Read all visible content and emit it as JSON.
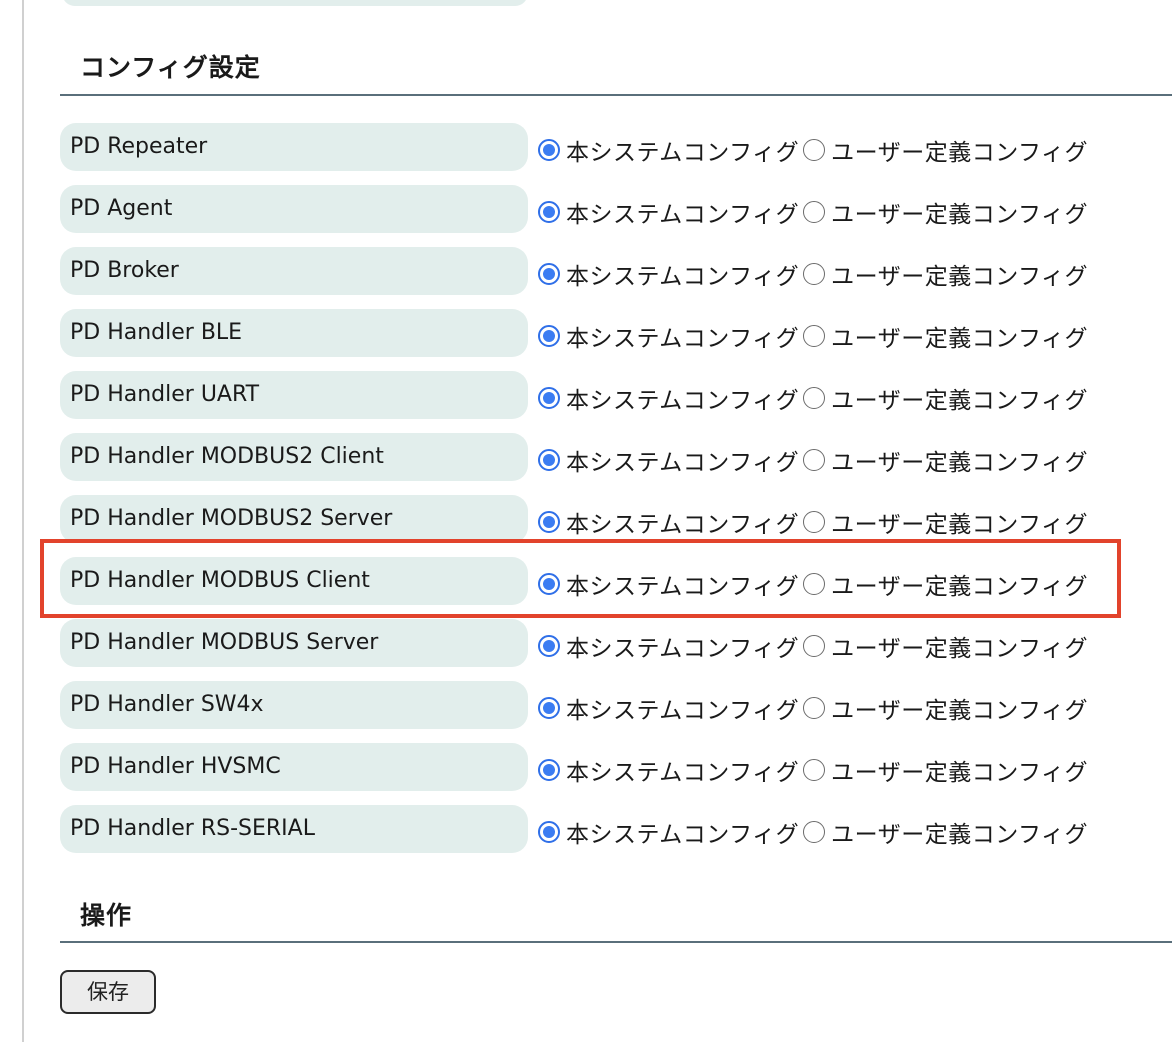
{
  "config_section": {
    "title": "コンフィグ設定",
    "option_system": "本システムコンフィグ",
    "option_user": "ユーザー定義コンフィグ",
    "rows": [
      {
        "label": "PD Repeater",
        "selected": "system"
      },
      {
        "label": "PD Agent",
        "selected": "system"
      },
      {
        "label": "PD Broker",
        "selected": "system"
      },
      {
        "label": "PD Handler BLE",
        "selected": "system"
      },
      {
        "label": "PD Handler UART",
        "selected": "system"
      },
      {
        "label": "PD Handler MODBUS2 Client",
        "selected": "system"
      },
      {
        "label": "PD Handler MODBUS2 Server",
        "selected": "system"
      },
      {
        "label": "PD Handler MODBUS Client",
        "selected": "system",
        "highlighted": true
      },
      {
        "label": "PD Handler MODBUS Server",
        "selected": "system"
      },
      {
        "label": "PD Handler SW4x",
        "selected": "system"
      },
      {
        "label": "PD Handler HVSMC",
        "selected": "system"
      },
      {
        "label": "PD Handler RS-SERIAL",
        "selected": "system"
      }
    ]
  },
  "operations_section": {
    "title": "操作",
    "save_label": "保存"
  },
  "colors": {
    "label_background": "#e2eeec",
    "radio_checked": "#3b7cf2",
    "highlight_border": "#e2432c",
    "section_rule": "#5a6f7b"
  }
}
